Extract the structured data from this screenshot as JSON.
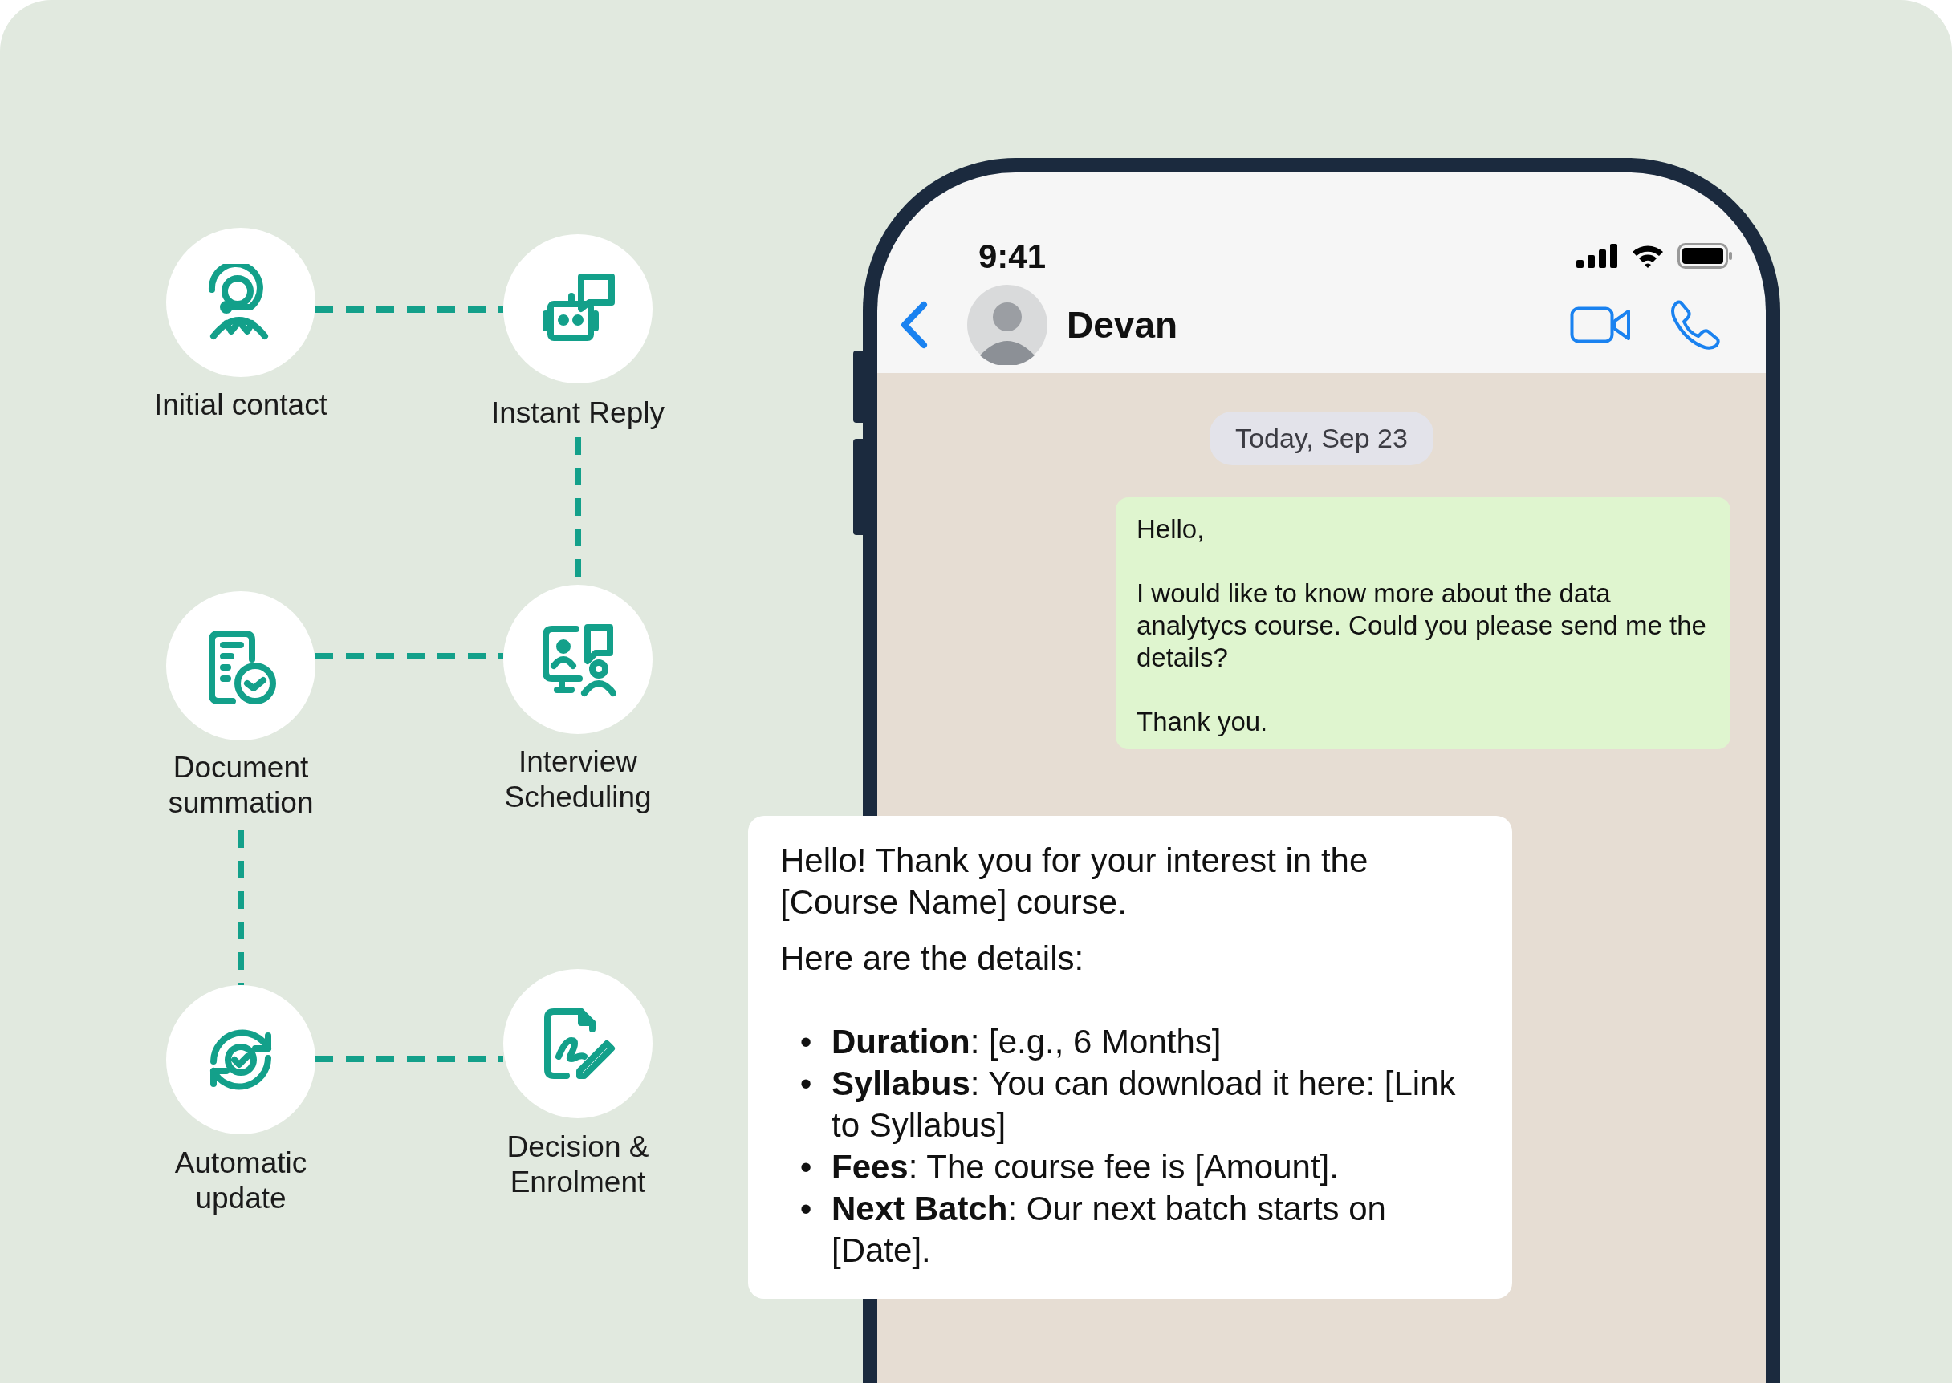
{
  "flow": {
    "steps": [
      {
        "label": "Initial contact"
      },
      {
        "label": "Instant Reply"
      },
      {
        "label": "Document summation"
      },
      {
        "label": "Interview Scheduling"
      },
      {
        "label": "Automatic update"
      },
      {
        "label": "Decision & Enrolment"
      }
    ]
  },
  "phone": {
    "status_bar": {
      "time": "9:41"
    },
    "chat_header": {
      "contact": "Devan"
    },
    "date_divider": "Today, Sep 23",
    "messages": [
      {
        "kind": "outgoing",
        "paragraphs": [
          "Hello,",
          "I would like to know more about the data analytycs course. Could you please send me the details?",
          "Thank you."
        ]
      }
    ]
  },
  "reply_card": {
    "paragraphs": [
      "Hello! Thank you for your interest in the [Course Name] course.",
      "Here are the details:"
    ],
    "bullets": [
      {
        "marker": "•",
        "text": "**Duration**: [e.g., 6 Months]"
      },
      {
        "marker": "•",
        "text": "**Syllabus**: You can download it here: [Link to Syllabus]"
      },
      {
        "marker": "•",
        "text": "**Fees**: The course fee is [Amount]."
      },
      {
        "marker": "•",
        "text": "**Next Batch**: Our next batch starts on [Date]."
      }
    ]
  }
}
